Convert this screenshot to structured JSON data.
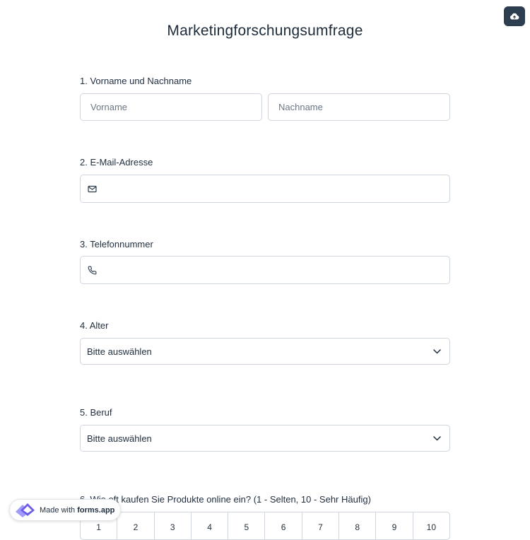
{
  "app": {
    "title": "Marketingforschungsumfrage",
    "accent_color": "#2c3e50",
    "save_icon": "cloud-upload-icon"
  },
  "questions": {
    "q1": {
      "label": "1. Vorname und Nachname",
      "first_placeholder": "Vorname",
      "last_placeholder": "Nachname"
    },
    "q2": {
      "label": "2. E-Mail-Adresse",
      "icon": "mail-icon"
    },
    "q3": {
      "label": "3. Telefonnummer",
      "icon": "phone-icon"
    },
    "q4": {
      "label": "4. Alter",
      "selected": "Bitte auswählen"
    },
    "q5": {
      "label": "5. Beruf",
      "selected": "Bitte auswählen"
    },
    "q6": {
      "label": "6. Wie oft kaufen Sie Produkte online ein? (1 - Selten, 10 - Sehr Häufig)",
      "options": [
        "1",
        "2",
        "3",
        "4",
        "5",
        "6",
        "7",
        "8",
        "9",
        "10"
      ]
    }
  },
  "footer": {
    "badge_prefix": "Made with",
    "badge_brand": "forms.app",
    "logo_colors": [
      "#6c5ce7",
      "#a29bfe"
    ]
  }
}
